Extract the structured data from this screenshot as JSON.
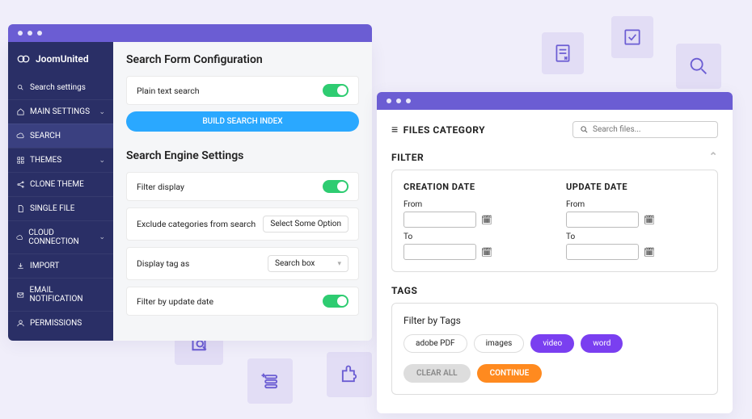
{
  "brand": "JoomUnited",
  "sidebar": {
    "search_label": "Search settings",
    "items": [
      {
        "icon": "home",
        "label": "MAIN SETTINGS",
        "chev": true
      },
      {
        "icon": "cloud",
        "label": "SEARCH",
        "chev": false,
        "active": true
      },
      {
        "icon": "grid",
        "label": "THEMES",
        "chev": true
      },
      {
        "icon": "share",
        "label": "CLONE THEME",
        "chev": false
      },
      {
        "icon": "file",
        "label": "SINGLE FILE",
        "chev": false
      },
      {
        "icon": "cloud",
        "label": "CLOUD CONNECTION",
        "chev": true
      },
      {
        "icon": "import",
        "label": "IMPORT",
        "chev": false
      },
      {
        "icon": "mail",
        "label": "EMAIL NOTIFICATION",
        "chev": false
      },
      {
        "icon": "user",
        "label": "PERMISSIONS",
        "chev": false
      }
    ]
  },
  "form": {
    "title": "Search Form Configuration",
    "plain_text": "Plain text search",
    "build_btn": "BUILD SEARCH INDEX",
    "engine_title": "Search Engine Settings",
    "filter_display": "Filter display",
    "exclude_cat": "Exclude categories from search",
    "exclude_opt": "Select Some Option",
    "display_tag": "Display tag as",
    "display_tag_opt": "Search box",
    "filter_update": "Filter by update date"
  },
  "files": {
    "title": "FILES CATEGORY",
    "search_ph": "Search files...",
    "filter_hdr": "FILTER",
    "creation": "CREATION DATE",
    "update": "UPDATE DATE",
    "from": "From",
    "to": "To",
    "tags_hdr": "TAGS",
    "filter_by_tags": "Filter by Tags",
    "tags": [
      {
        "label": "adobe PDF",
        "on": false
      },
      {
        "label": "images",
        "on": false
      },
      {
        "label": "video",
        "on": true
      },
      {
        "label": "word",
        "on": true
      }
    ],
    "clear": "CLEAR ALL",
    "continue": "CONTINUE"
  }
}
